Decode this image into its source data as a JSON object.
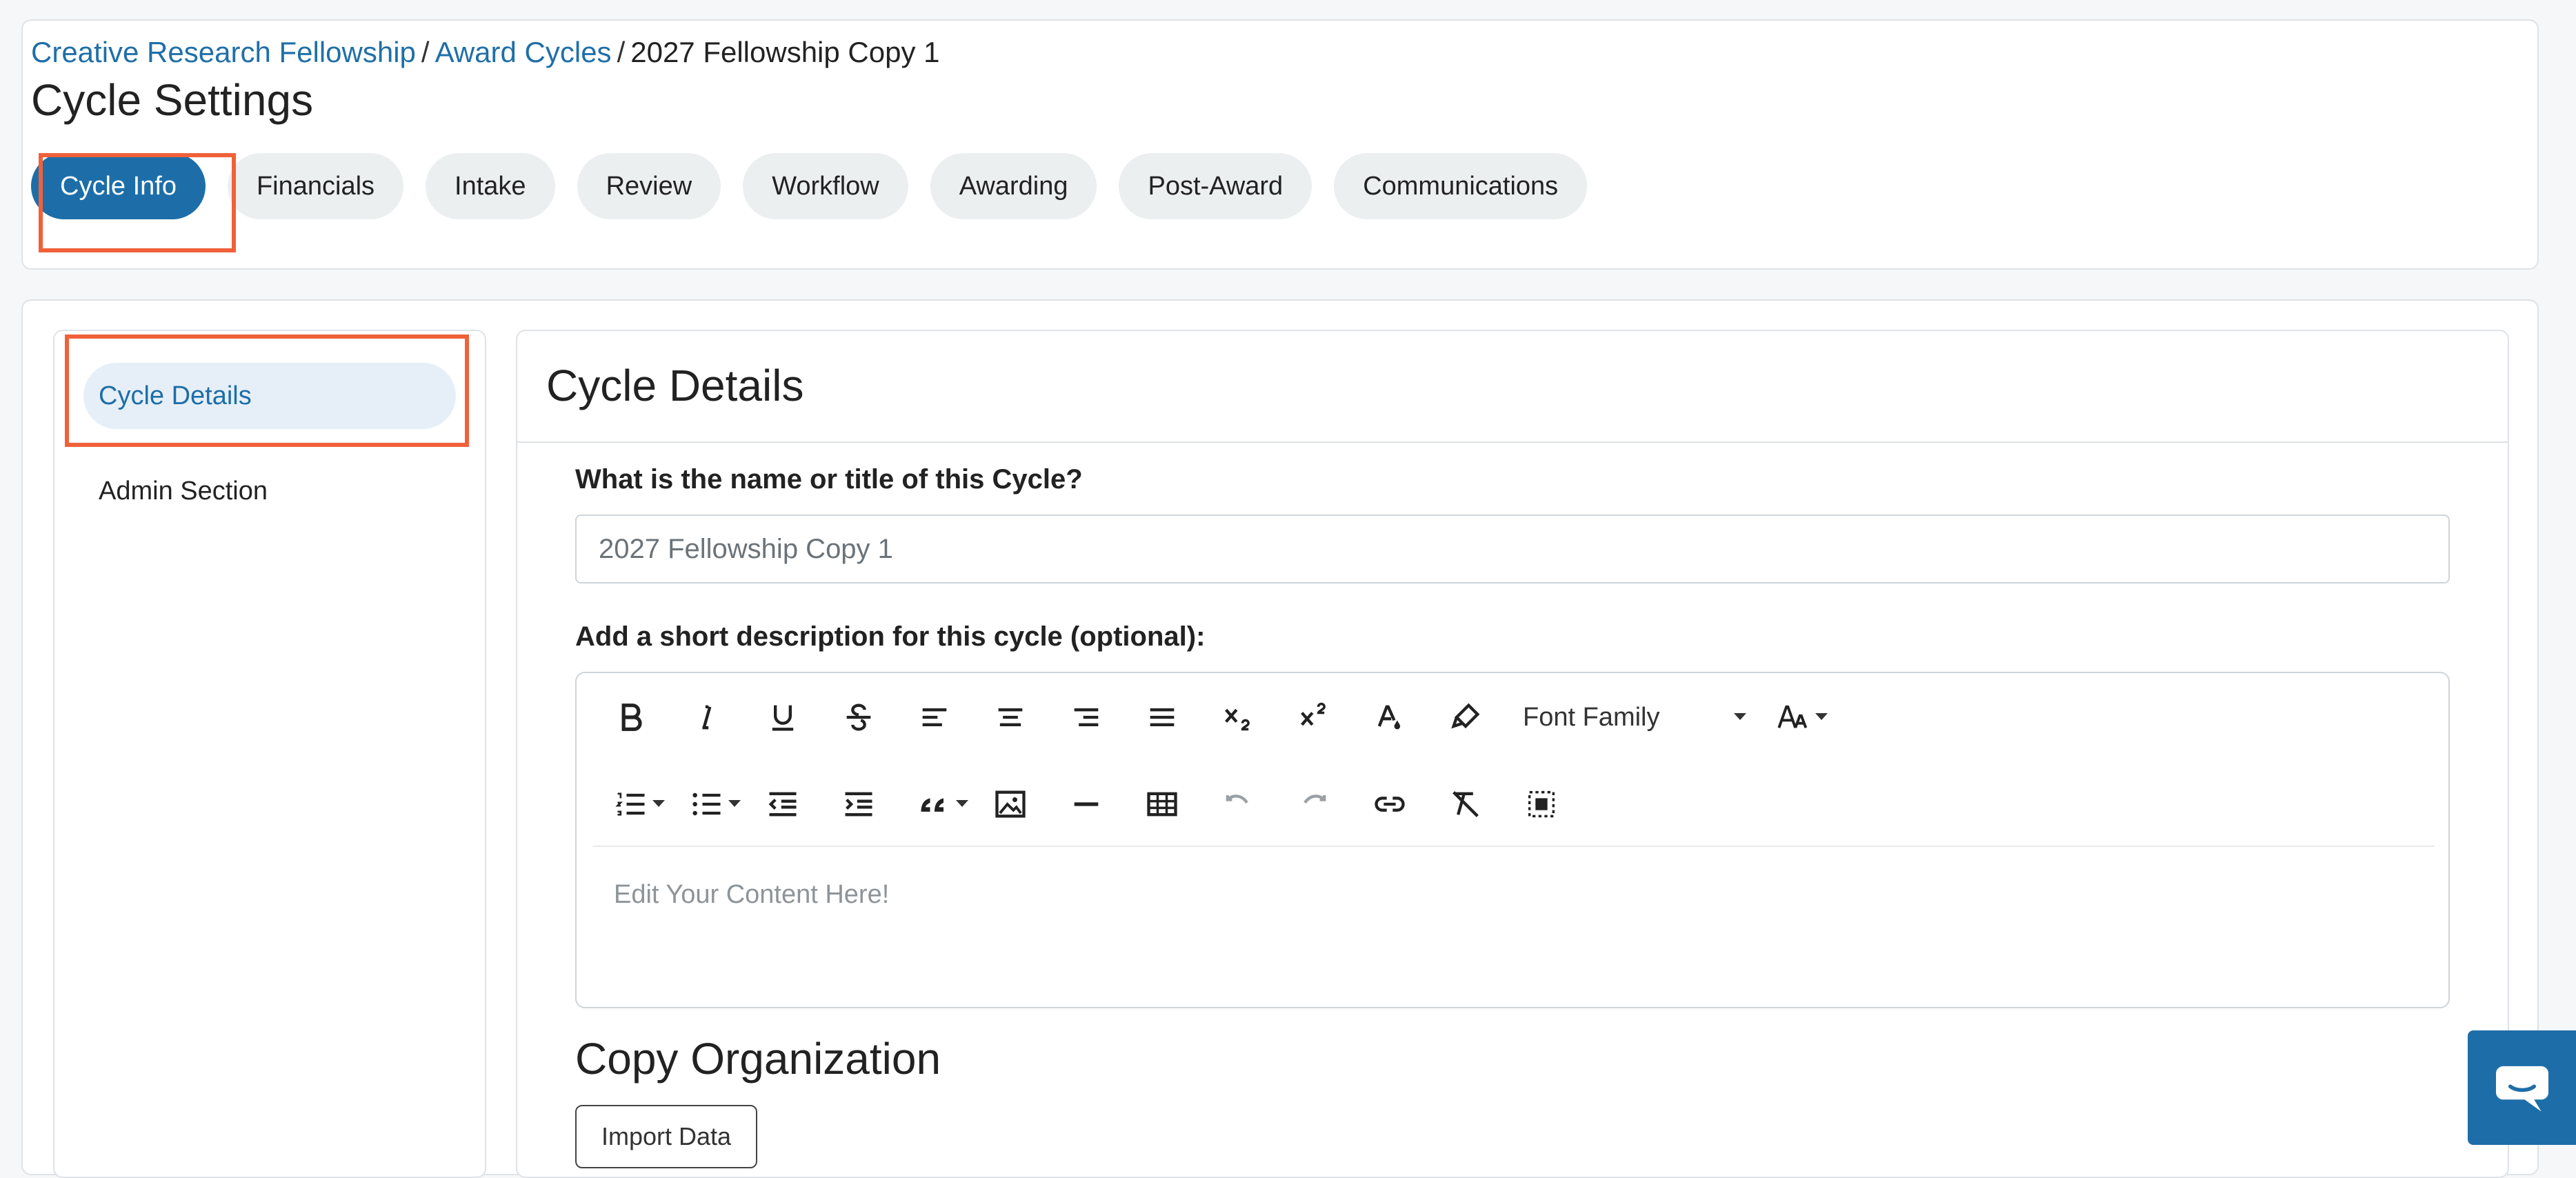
{
  "breadcrumb": {
    "items": [
      {
        "label": "Creative Research Fellowship",
        "link": true
      },
      {
        "label": "Award Cycles",
        "link": true
      },
      {
        "label": "2027 Fellowship Copy 1",
        "link": false
      }
    ],
    "separator": "/"
  },
  "page": {
    "title": "Cycle Settings"
  },
  "tabs": [
    {
      "label": "Cycle Info",
      "active": true
    },
    {
      "label": "Financials",
      "active": false
    },
    {
      "label": "Intake",
      "active": false
    },
    {
      "label": "Review",
      "active": false
    },
    {
      "label": "Workflow",
      "active": false
    },
    {
      "label": "Awarding",
      "active": false
    },
    {
      "label": "Post-Award",
      "active": false
    },
    {
      "label": "Communications",
      "active": false
    }
  ],
  "sidenav": {
    "items": [
      {
        "label": "Cycle Details",
        "active": true
      },
      {
        "label": "Admin Section",
        "active": false
      }
    ]
  },
  "panel": {
    "title": "Cycle Details",
    "name_label": "What is the name or title of this Cycle?",
    "name_value": "2027 Fellowship Copy 1",
    "description_label": "Add a short description for this cycle (optional):",
    "editor": {
      "font_family_label": "Font Family",
      "placeholder": "Edit Your Content Here!",
      "toolbar_row1": [
        "bold-icon",
        "italic-icon",
        "underline-icon",
        "strikethrough-icon",
        "align-left-icon",
        "align-center-icon",
        "align-right-icon",
        "align-justify-icon",
        "subscript-icon",
        "superscript-icon",
        "text-color-icon",
        "highlight-icon"
      ],
      "toolbar_row2": [
        "ordered-list-icon",
        "unordered-list-icon",
        "outdent-icon",
        "indent-icon",
        "quote-icon",
        "image-icon",
        "horizontal-rule-icon",
        "table-icon",
        "undo-icon",
        "redo-icon",
        "link-icon",
        "clear-format-icon",
        "select-all-icon"
      ]
    },
    "copy_section_title": "Copy Organization",
    "import_button_label": "Import Data"
  },
  "colors": {
    "accent": "#1d6ea8",
    "highlight": "#f0613a",
    "link": "#1f6fa8"
  },
  "chat": {
    "icon": "chat-bubble-icon"
  }
}
